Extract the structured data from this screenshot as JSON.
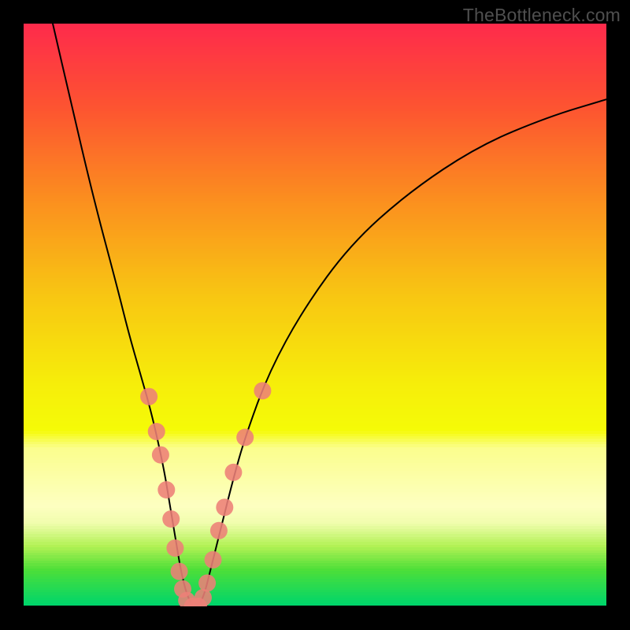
{
  "watermark": "TheBottleneck.com",
  "chart_data": {
    "type": "line",
    "title": "",
    "xlabel": "",
    "ylabel": "",
    "xlim": [
      0,
      100
    ],
    "ylim": [
      0,
      100
    ],
    "legend": false,
    "grid": false,
    "background_gradient_stops": [
      {
        "pct": 0,
        "color": "#fe2b4b"
      },
      {
        "pct": 14,
        "color": "#fd5331"
      },
      {
        "pct": 30,
        "color": "#fb8e1f"
      },
      {
        "pct": 46,
        "color": "#f8c413"
      },
      {
        "pct": 62,
        "color": "#f6ee0a"
      },
      {
        "pct": 70,
        "color": "#f5fb07"
      },
      {
        "pct": 73,
        "color": "#fbfe8d"
      },
      {
        "pct": 83,
        "color": "#fdffc1"
      },
      {
        "pct": 86,
        "color": "#f0fdad"
      },
      {
        "pct": 90,
        "color": "#b1f154"
      },
      {
        "pct": 94,
        "color": "#4edf38"
      },
      {
        "pct": 100,
        "color": "#00d56a"
      }
    ],
    "series": [
      {
        "name": "bottleneck-curve",
        "x": [
          5,
          8,
          12,
          16,
          18,
          20,
          22,
          24,
          25,
          26,
          27,
          28,
          29,
          30,
          31,
          32,
          34,
          36,
          38,
          42,
          48,
          56,
          66,
          78,
          90,
          100
        ],
        "y": [
          100,
          87,
          70,
          55,
          47,
          40,
          33,
          24,
          18,
          12,
          6,
          2,
          0,
          0,
          2,
          6,
          14,
          22,
          29,
          40,
          51,
          62,
          71,
          79,
          84,
          87
        ]
      }
    ],
    "markers": [
      {
        "x": 21.5,
        "y": 36
      },
      {
        "x": 22.8,
        "y": 30
      },
      {
        "x": 23.5,
        "y": 26
      },
      {
        "x": 24.5,
        "y": 20
      },
      {
        "x": 25.3,
        "y": 15
      },
      {
        "x": 26.0,
        "y": 10
      },
      {
        "x": 26.7,
        "y": 6
      },
      {
        "x": 27.3,
        "y": 3
      },
      {
        "x": 28.0,
        "y": 1
      },
      {
        "x": 29.0,
        "y": 0
      },
      {
        "x": 30.0,
        "y": 0
      },
      {
        "x": 30.8,
        "y": 1.5
      },
      {
        "x": 31.5,
        "y": 4
      },
      {
        "x": 32.5,
        "y": 8
      },
      {
        "x": 33.5,
        "y": 13
      },
      {
        "x": 34.5,
        "y": 17
      },
      {
        "x": 36.0,
        "y": 23
      },
      {
        "x": 38.0,
        "y": 29
      },
      {
        "x": 41.0,
        "y": 37
      }
    ],
    "marker_style": {
      "shape": "circle",
      "color": "#ed7f78",
      "opacity": 0.88,
      "radius_px": 11
    }
  }
}
